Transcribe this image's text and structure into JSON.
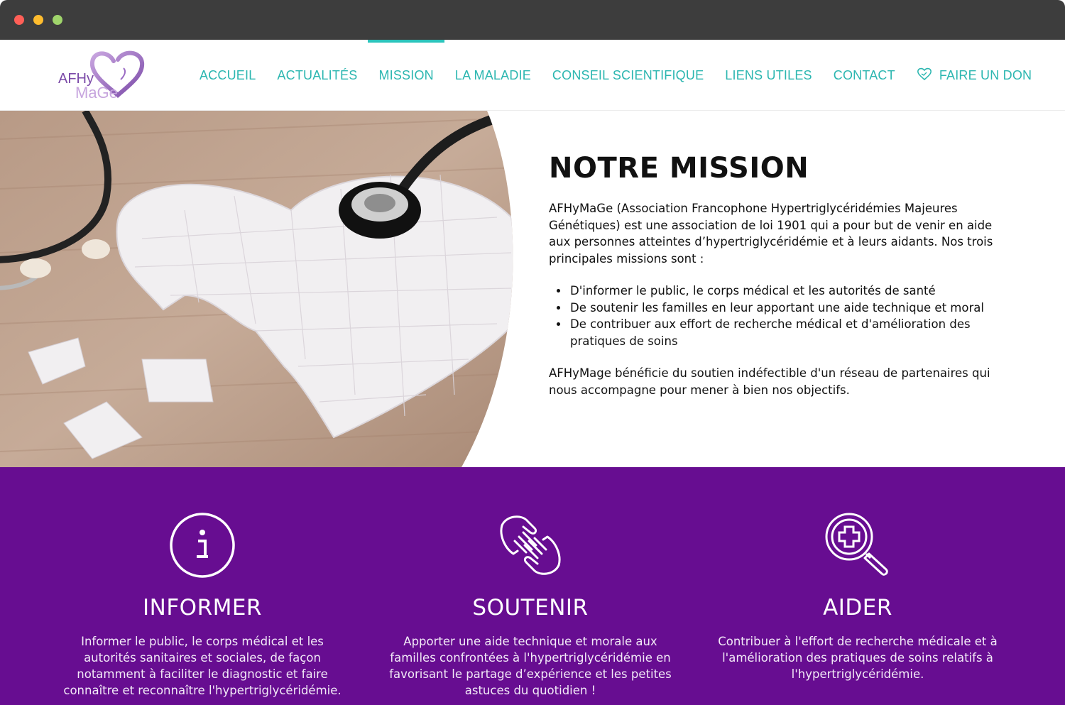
{
  "logo": {
    "line1": "AFHy",
    "line2": "MaGe"
  },
  "nav": {
    "items": [
      "ACCUEIL",
      "ACTUALITÉS",
      "MISSION",
      "LA MALADIE",
      "CONSEIL SCIENTIFIQUE",
      "LIENS UTILES",
      "CONTACT"
    ],
    "donate": "FAIRE UN DON",
    "active": "MISSION"
  },
  "colors": {
    "teal": "#2bb6b0",
    "purple": "#670d91",
    "logo_purple": "#7b4aa8"
  },
  "mission": {
    "title": "NOTRE MISSION",
    "intro": "AFHyMaGe (Association Francophone Hypertriglycéridémies Majeures Génétiques) est une association de loi 1901 qui a pour but de venir en aide aux personnes atteintes d’hypertriglycéridémie et à leurs aidants. Nos trois principales missions sont :",
    "bullets": [
      "D'informer le public, le corps médical et les autorités de santé",
      "De soutenir les familles en leur apportant une aide technique et moral",
      "De contribuer aux effort de recherche médical et d'amélioration des pratiques de soins"
    ],
    "outro": "AFHyMage bénéficie du soutien indéfectible d'un réseau de partenaires qui nous accompagne pour mener à bien nos objectifs."
  },
  "pillars": [
    {
      "icon": "info-icon",
      "title": "INFORMER",
      "text": "Informer le public, le corps médical et les autorités sanitaires et sociales, de façon notamment à faciliter le diagnostic et faire connaître et reconnaître l'hypertriglycéridémie."
    },
    {
      "icon": "helping-hands-icon",
      "title": "SOUTENIR",
      "text": "Apporter une aide technique et morale aux familles confrontées à l'hypertriglycéridémie en favorisant le partage d’expérience et les petites astuces du quotidien !"
    },
    {
      "icon": "medical-search-icon",
      "title": "AIDER",
      "text": "Contribuer à l'effort de recherche médicale et à l'amélioration des pratiques de soins relatifs à l'hypertriglycéridémie."
    }
  ]
}
